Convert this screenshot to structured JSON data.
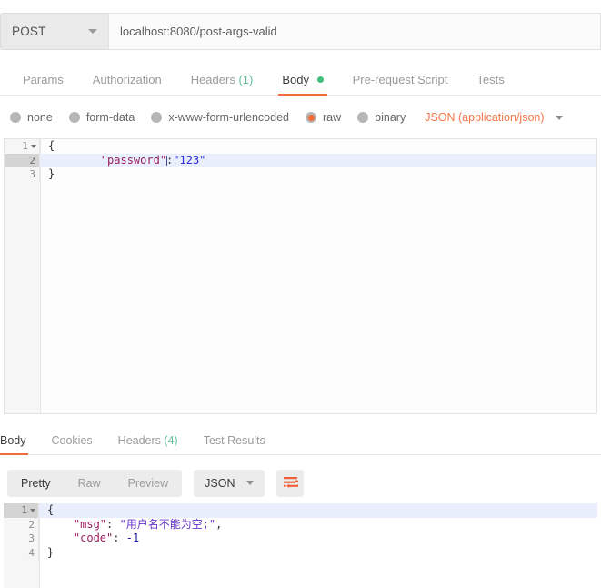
{
  "request": {
    "method": "POST",
    "url": "localhost:8080/post-args-valid",
    "tabs": [
      {
        "label": "Params",
        "active": false
      },
      {
        "label": "Authorization",
        "active": false
      },
      {
        "label": "Headers",
        "count": "(1)",
        "active": false
      },
      {
        "label": "Body",
        "active": true,
        "dot": true
      },
      {
        "label": "Pre-request Script",
        "active": false
      },
      {
        "label": "Tests",
        "active": false
      }
    ],
    "body_types": [
      {
        "label": "none",
        "selected": false
      },
      {
        "label": "form-data",
        "selected": false
      },
      {
        "label": "x-www-form-urlencoded",
        "selected": false
      },
      {
        "label": "raw",
        "selected": true
      },
      {
        "label": "binary",
        "selected": false
      }
    ],
    "content_type": "JSON (application/json)",
    "editor": {
      "lines": [
        {
          "number": "1",
          "fold": true,
          "active": false
        },
        {
          "number": "2",
          "fold": false,
          "active": true
        },
        {
          "number": "3",
          "fold": false,
          "active": false
        }
      ],
      "line1_open_brace": "{",
      "line2_key": "\"password\"",
      "line2_colon": ":",
      "line2_value": "\"123\"",
      "line3_close_brace": "}"
    }
  },
  "response": {
    "tabs": [
      {
        "label": "Body",
        "active": true
      },
      {
        "label": "Cookies",
        "active": false
      },
      {
        "label": "Headers",
        "count": "(4)",
        "active": false
      },
      {
        "label": "Test Results",
        "active": false
      }
    ],
    "view_modes": [
      {
        "label": "Pretty",
        "active": true
      },
      {
        "label": "Raw",
        "active": false
      },
      {
        "label": "Preview",
        "active": false
      }
    ],
    "format": "JSON",
    "wrap_icon": "word-wrap-icon",
    "editor": {
      "lines": [
        {
          "number": "1",
          "fold": true,
          "active": true
        },
        {
          "number": "2",
          "fold": false,
          "active": false
        },
        {
          "number": "3",
          "fold": false,
          "active": false
        },
        {
          "number": "4",
          "fold": false,
          "active": false
        }
      ],
      "line1_open_brace": "{",
      "line2_key": "\"msg\"",
      "line2_colon": ": ",
      "line2_value": "\"用户名不能为空;\"",
      "line2_comma": ",",
      "line3_key": "\"code\"",
      "line3_colon": ": ",
      "line3_value": "-1",
      "line4_close_brace": "}"
    }
  },
  "colors": {
    "accent": "#ef6c3f",
    "orange_text": "#f47747",
    "green_dot": "#3fbf79",
    "green_count": "#64c39a",
    "active_line": "#e8eefc",
    "json_key": "#9b1d61",
    "json_string": "#6633cc",
    "json_number": "#1a1aa8"
  }
}
